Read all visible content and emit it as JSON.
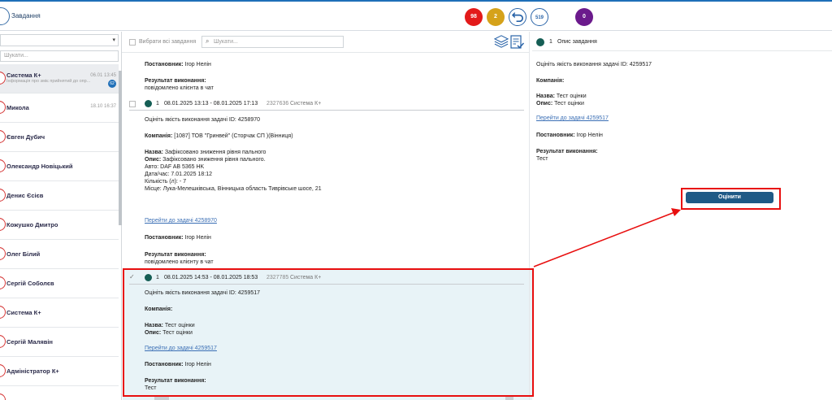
{
  "topbar": {
    "title": "Завдання",
    "badges": {
      "red": "98",
      "yellow": "2",
      "count": "519",
      "purple": "0"
    }
  },
  "left": {
    "search_placeholder": "Шукати...",
    "contacts": [
      {
        "name": "Система К+",
        "time": "06.01 13:45",
        "message": "Інформація про зміє прийнятий до опр...",
        "unread": "62"
      },
      {
        "name": "Микола",
        "time": "18.10 16:37"
      },
      {
        "name": "Євген Дубич"
      },
      {
        "name": "Олександр Новіцький"
      },
      {
        "name": "Денис Єсієв"
      },
      {
        "name": "Кожушко Дмитро"
      },
      {
        "name": "Олег Білий"
      },
      {
        "name": "Сергій Соболєв"
      },
      {
        "name": "Система К+"
      },
      {
        "name": "Сергій Малявін"
      },
      {
        "name": "Адміністратор К+"
      }
    ]
  },
  "middle": {
    "select_all_label": "Вибрати всі завдання",
    "search_placeholder": "Шукати...",
    "top_block": {
      "setter_label": "Постановник:",
      "setter": "Ігор Нелін",
      "result_label": "Результат виконання:",
      "result": "повідомлено клієнта в чат"
    },
    "tasks": [
      {
        "num": "1",
        "range": "08.01.2025 13:13 - 08.01.2025 17:13",
        "id": "2327636",
        "source": "Система К+",
        "title": "Оцініть якість виконання задачі ID: 4258970",
        "company_label": "Компанія:",
        "company": "[1087] ТОВ \"Гринвей\" (Сторчак СП )(Вінниця)",
        "name_label": "Назва:",
        "name": "Зафіксовано зниження рівня пального",
        "desc_label": "Опис:",
        "desc": "Зафіксовано зниження рівня пального.",
        "auto": "Авто: DAF AB 5365 HK",
        "datetime": "Дата/час: 7.01.2025 18:12",
        "qty": "Кількість (л): - 7",
        "place": "Місце: Лука-Мелешківська, Вінницька область Тиврівське шосе, 21",
        "link": "Перейти до задачі 4258970",
        "setter_label": "Постановник:",
        "setter": "Ігор Нелін",
        "result_label": "Результат виконання:",
        "result": "повідомлено клієнту в чат"
      },
      {
        "num": "1",
        "range": "08.01.2025 14:53 - 08.01.2025 18:53",
        "id": "2327785",
        "source": "Система К+",
        "title": "Оцініть якість виконання задачі ID: 4259517",
        "company_label": "Компанія:",
        "name_label": "Назва:",
        "name": "Тест оцінки",
        "desc_label": "Опис:",
        "desc": "Тест оцінки",
        "link": "Перейти до задачі 4259517",
        "setter_label": "Постановник:",
        "setter": "Ігор Нелін",
        "result_label": "Результат виконання:",
        "result": "Тест"
      }
    ]
  },
  "right": {
    "num": "1",
    "title": "Опис завдання",
    "task_title": "Оцініть якість виконання задачі ID: 4259517",
    "company_label": "Компанія:",
    "name_label": "Назва:",
    "name": "Тест оцінки",
    "desc_label": "Опис:",
    "desc": "Тест оцінки",
    "link": "Перейти до задачі 4259517",
    "setter_label": "Постановник:",
    "setter": "Ігор Нелін",
    "result_label": "Результат виконання:",
    "result": "Тест",
    "rate_button": "Оцінити"
  },
  "colors": {
    "accent": "#1f5a86",
    "status_dot": "#155e55",
    "highlight": "#e80f0f"
  }
}
